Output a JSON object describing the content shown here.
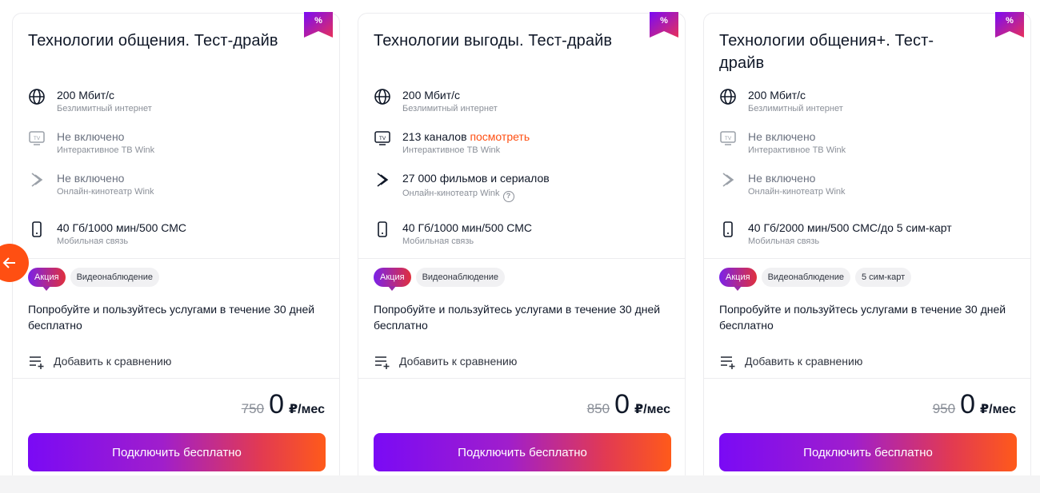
{
  "colors": {
    "accent": "#ff4f12",
    "gradient_start": "#7a0af5",
    "gradient_end": "#ff5a1a",
    "text": "#101828",
    "muted": "#8a8f98"
  },
  "nav": {
    "prev_icon": "arrow-left-icon"
  },
  "cards": [
    {
      "badge": "%",
      "title": "Технологии общения. Тест-драйв",
      "features": {
        "internet": {
          "icon": "globe-icon",
          "main": "200 Мбит/с",
          "sub": "Безлимитный интернет"
        },
        "tv": {
          "icon": "tv-icon",
          "main": "Не включено",
          "sub": "Интерактивное ТВ Wink"
        },
        "cinema": {
          "icon": "play-diamond-icon",
          "main": "Не включено",
          "sub": "Онлайн-кинотеатр Wink"
        },
        "mobile": {
          "icon": "phone-icon",
          "main": "40 Гб/1000 мин/500 СМС",
          "sub": "Мобильная связь"
        }
      },
      "tags": [
        "Акция",
        "Видеонаблюдение"
      ],
      "description": "Попробуйте и пользуйтесь услугами в течение 30 дней бесплатно",
      "compare_label": "Добавить к сравнению",
      "price": {
        "old": "750",
        "current": "0",
        "unit": "₽/мес"
      },
      "cta_label": "Подключить бесплатно"
    },
    {
      "badge": "%",
      "title": "Технологии выгоды. Тест-драйв",
      "features": {
        "internet": {
          "icon": "globe-icon",
          "main": "200 Мбит/с",
          "sub": "Безлимитный интернет"
        },
        "tv": {
          "icon": "tv-icon",
          "main": "213 каналов",
          "link": "посмотреть",
          "sub": "Интерактивное ТВ Wink"
        },
        "cinema": {
          "icon": "play-diamond-icon",
          "main": "27 000 фильмов и сериалов",
          "sub": "Онлайн-кинотеатр Wink",
          "help": "?"
        },
        "mobile": {
          "icon": "phone-icon",
          "main": "40 Гб/1000 мин/500 СМС",
          "sub": "Мобильная связь"
        }
      },
      "tags": [
        "Акция",
        "Видеонаблюдение"
      ],
      "description": "Попробуйте и пользуйтесь услугами в течение 30 дней бесплатно",
      "compare_label": "Добавить к сравнению",
      "price": {
        "old": "850",
        "current": "0",
        "unit": "₽/мес"
      },
      "cta_label": "Подключить бесплатно"
    },
    {
      "badge": "%",
      "title": "Технологии общения+. Тест-драйв",
      "features": {
        "internet": {
          "icon": "globe-icon",
          "main": "200 Мбит/с",
          "sub": "Безлимитный интернет"
        },
        "tv": {
          "icon": "tv-icon",
          "main": "Не включено",
          "sub": "Интерактивное ТВ Wink"
        },
        "cinema": {
          "icon": "play-diamond-icon",
          "main": "Не включено",
          "sub": "Онлайн-кинотеатр Wink"
        },
        "mobile": {
          "icon": "phone-icon",
          "main": "40 Гб/2000 мин/500 СМС/до 5 сим-карт",
          "sub": "Мобильная связь"
        }
      },
      "tags": [
        "Акция",
        "Видеонаблюдение",
        "5 сим-карт"
      ],
      "description": "Попробуйте и пользуйтесь услугами в течение 30 дней бесплатно",
      "compare_label": "Добавить к сравнению",
      "price": {
        "old": "950",
        "current": "0",
        "unit": "₽/мес"
      },
      "cta_label": "Подключить бесплатно"
    }
  ]
}
